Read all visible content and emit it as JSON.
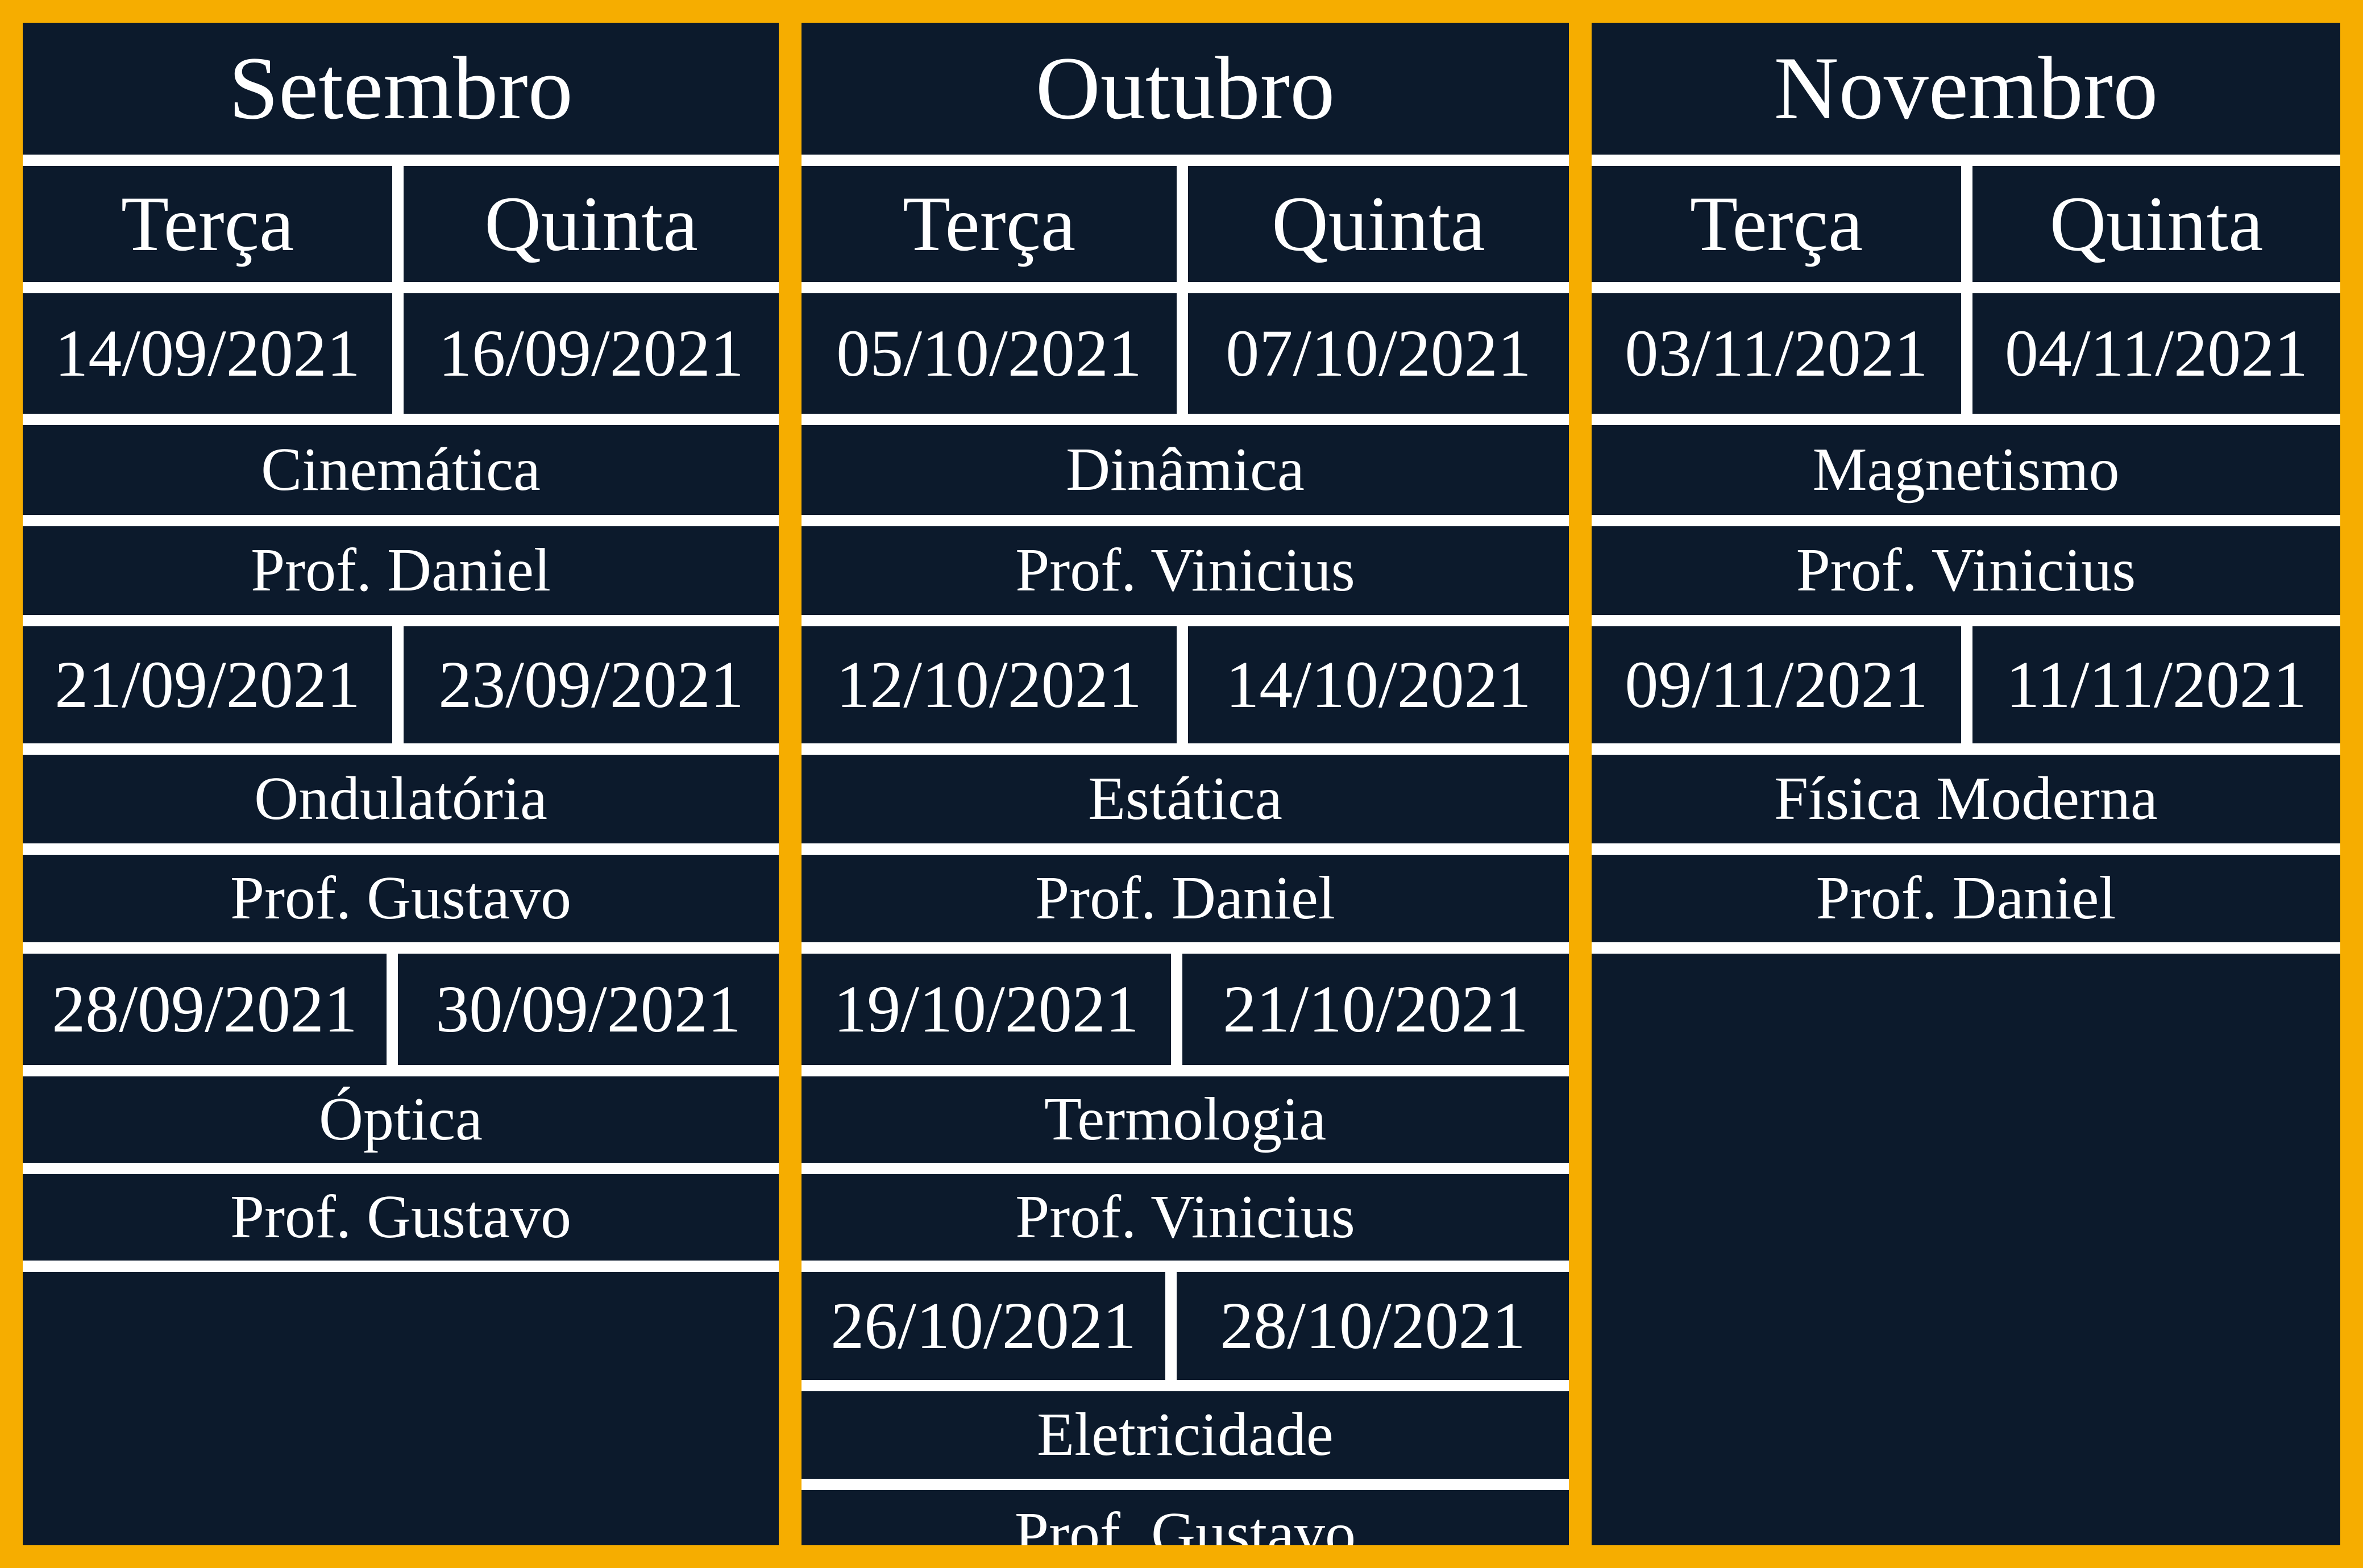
{
  "months": [
    {
      "name": "Setembro",
      "days": [
        "Terça",
        "Quinta"
      ],
      "blocks": [
        {
          "dates": [
            "14/09/2021",
            "16/09/2021"
          ],
          "topic": "Cinemática",
          "prof": "Prof. Daniel"
        },
        {
          "dates": [
            "21/09/2021",
            "23/09/2021"
          ],
          "topic": "Ondulatória",
          "prof": "Prof. Gustavo"
        },
        {
          "dates": [
            "28/09/2021",
            "30/09/2021"
          ],
          "topic": "Óptica",
          "prof": "Prof. Gustavo"
        }
      ]
    },
    {
      "name": "Outubro",
      "days": [
        "Terça",
        "Quinta"
      ],
      "blocks": [
        {
          "dates": [
            "05/10/2021",
            "07/10/2021"
          ],
          "topic": "Dinâmica",
          "prof": "Prof. Vinicius"
        },
        {
          "dates": [
            "12/10/2021",
            "14/10/2021"
          ],
          "topic": "Estática",
          "prof": "Prof. Daniel"
        },
        {
          "dates": [
            "19/10/2021",
            "21/10/2021"
          ],
          "topic": "Termologia",
          "prof": "Prof. Vinicius"
        },
        {
          "dates": [
            "26/10/2021",
            "28/10/2021"
          ],
          "topic": "Eletricidade",
          "prof": "Prof. Gustavo"
        }
      ]
    },
    {
      "name": "Novembro",
      "days": [
        "Terça",
        "Quinta"
      ],
      "blocks": [
        {
          "dates": [
            "03/11/2021",
            "04/11/2021"
          ],
          "topic": "Magnetismo",
          "prof": "Prof. Vinicius"
        },
        {
          "dates": [
            "09/11/2021",
            "11/11/2021"
          ],
          "topic": "Física Moderna",
          "prof": "Prof. Daniel"
        }
      ]
    }
  ]
}
